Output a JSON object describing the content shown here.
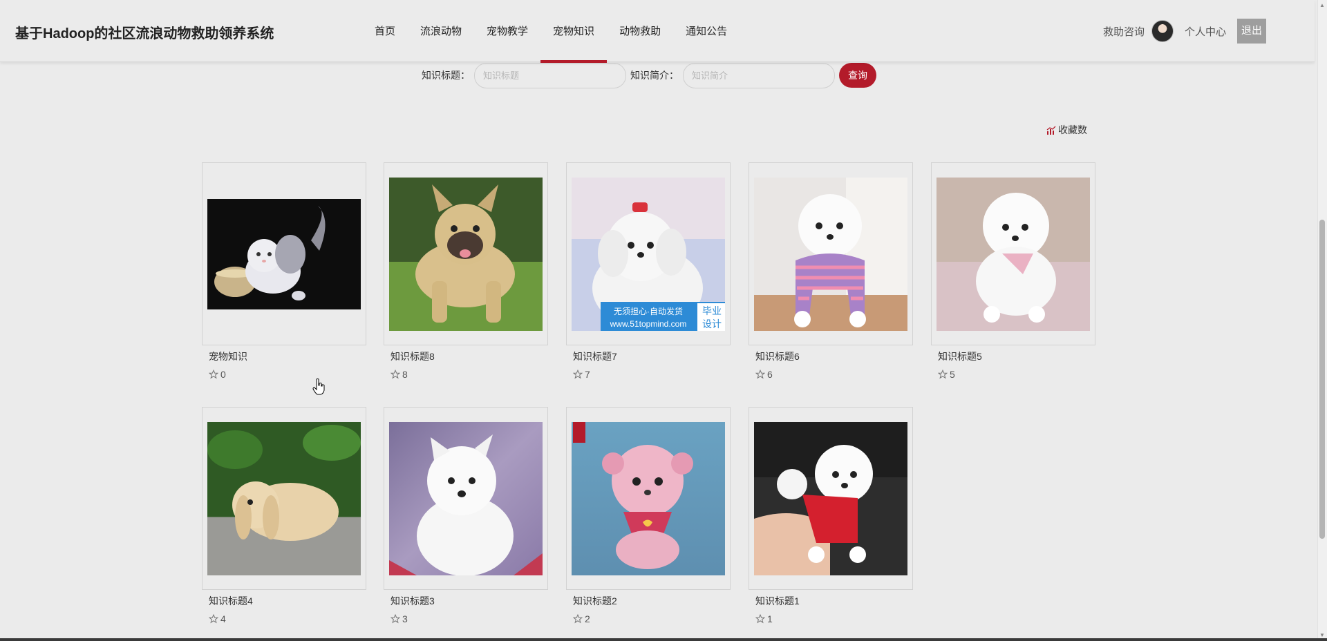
{
  "header": {
    "site_title": "基于Hadoop的社区流浪动物救助领养系统",
    "nav": [
      {
        "label": "首页",
        "active": false
      },
      {
        "label": "流浪动物",
        "active": false
      },
      {
        "label": "宠物教学",
        "active": false
      },
      {
        "label": "宠物知识",
        "active": true
      },
      {
        "label": "动物救助",
        "active": false
      },
      {
        "label": "通知公告",
        "active": false
      }
    ],
    "help_label": "救助咨询",
    "profile_label": "个人中心",
    "logout_label": "退出"
  },
  "search": {
    "title_label": "知识标题：",
    "title_placeholder": "知识标题",
    "intro_label": "知识简介：",
    "intro_placeholder": "知识简介",
    "query_label": "查询"
  },
  "sort": {
    "label": "收藏数",
    "icon": "bar-chart-icon"
  },
  "cards": [
    {
      "title": "宠物知识",
      "favorites": "0",
      "image": "gray-kitten"
    },
    {
      "title": "知识标题8",
      "favorites": "8",
      "image": "french-bulldog"
    },
    {
      "title": "知识标题7",
      "favorites": "7",
      "image": "white-maltese"
    },
    {
      "title": "知识标题6",
      "favorites": "6",
      "image": "pomeranian-striped-sweater"
    },
    {
      "title": "知识标题5",
      "favorites": "5",
      "image": "white-pomeranian"
    },
    {
      "title": "知识标题4",
      "favorites": "4",
      "image": "lop-rabbit"
    },
    {
      "title": "知识标题3",
      "favorites": "3",
      "image": "samoyed-puppy"
    },
    {
      "title": "知识标题2",
      "favorites": "2",
      "image": "pink-pomeranian"
    },
    {
      "title": "知识标题1",
      "favorites": "1",
      "image": "pomeranian-red-sweater"
    }
  ],
  "watermark": {
    "line1": "无须担心·自动发货",
    "line2": "www.51topmind.com",
    "badge_line1": "毕业",
    "badge_line2": "设计"
  },
  "colors": {
    "accent": "#b31b2a",
    "background": "#ebebeb"
  }
}
